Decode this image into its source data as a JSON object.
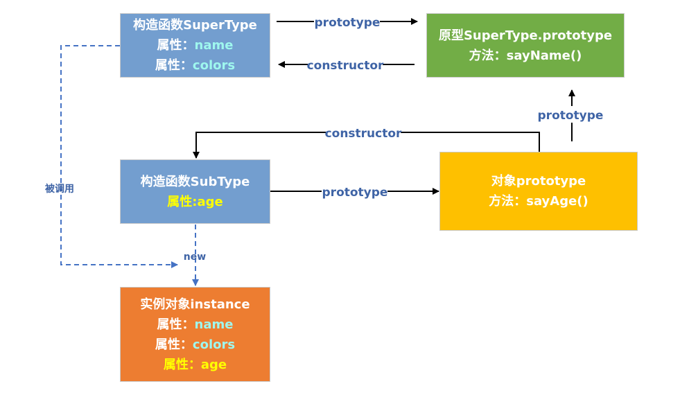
{
  "colors": {
    "constructor_box": "#739ecf",
    "super_prototype_box": "#72ad46",
    "sub_prototype_box": "#fec000",
    "instance_box": "#ed7d31",
    "edge_label": "#3f64a6",
    "dashed_arrow": "#4472c4",
    "cyan_text": "#9ef7ee",
    "yellow_text": "#ffff00"
  },
  "nodes": {
    "supertype": {
      "title": "构造函数SuperType",
      "props": [
        {
          "name": "属性：",
          "value": "name"
        },
        {
          "name": "属性：",
          "value": "colors"
        }
      ]
    },
    "super_prototype": {
      "title": "原型SuperType.prototype",
      "method": "方法：sayName()"
    },
    "subtype": {
      "title": "构造函数SubType",
      "prop": "属性:age"
    },
    "sub_prototype": {
      "title": "对象prototype",
      "method": "方法：sayAge()"
    },
    "instance": {
      "title": "实例对象instance",
      "props": [
        {
          "name": "属性：",
          "value": "name"
        },
        {
          "name": "属性：",
          "value": "colors"
        },
        {
          "name": "属性：",
          "value": "age"
        }
      ]
    }
  },
  "edges": {
    "super_prototype_link": "prototype",
    "super_constructor_link": "constructor",
    "sub_proto_to_super_proto": "prototype",
    "sub_proto_constructor": "constructor",
    "sub_prototype_link": "prototype",
    "called_by": "被调用",
    "new_instance": "new"
  }
}
